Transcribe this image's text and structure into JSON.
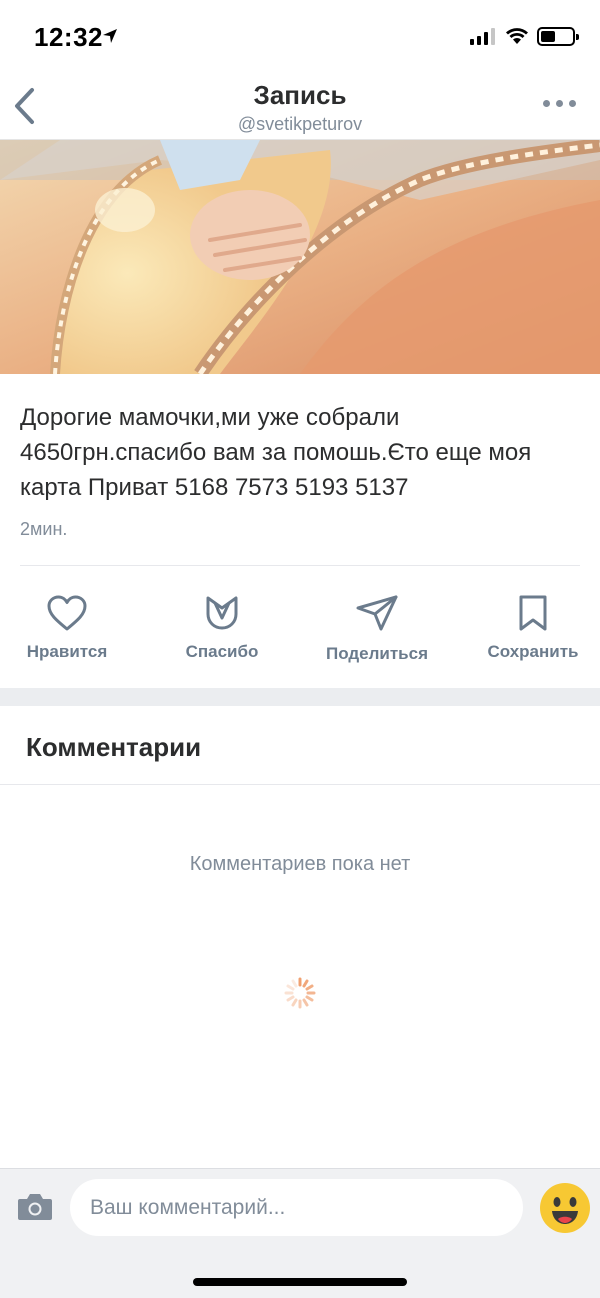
{
  "status_bar": {
    "time": "12:32"
  },
  "nav": {
    "title": "Запись",
    "subtitle": "@svetikpeturov",
    "back_icon": "chevron-left-icon",
    "more_icon": "more-horizontal-icon"
  },
  "post": {
    "image_alt": "baby hand on peach blanket",
    "text": "Дорогие мамочки,ми уже собрали 4650грн.спасибо вам за помошь.Єто еще моя карта Приват 5168 7573 5193 5137",
    "time": "2мин."
  },
  "actions": [
    {
      "label": "Нравится",
      "icon": "heart-icon"
    },
    {
      "label": "Спасибо",
      "icon": "flower-icon"
    },
    {
      "label": "Поделиться",
      "icon": "share-icon"
    },
    {
      "label": "Сохранить",
      "icon": "bookmark-icon"
    }
  ],
  "comments": {
    "title": "Комментарии",
    "empty_text": "Комментариев пока нет"
  },
  "composer": {
    "placeholder": "Ваш комментарий...",
    "camera_icon": "camera-icon",
    "emoji_icon": "smile-emoji-icon"
  },
  "colors": {
    "accent_icon": "#6b7b8c",
    "secondary_text": "#818c99",
    "emoji_yellow": "#f7c833"
  }
}
